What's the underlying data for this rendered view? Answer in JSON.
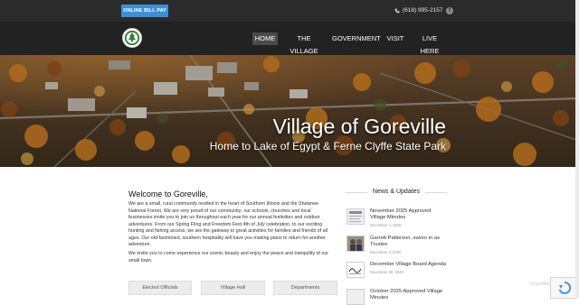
{
  "topbar": {
    "pay_label": "ONLINE BILL PAY",
    "phone": "(618) 995-2157",
    "fb_glyph": "f"
  },
  "nav": {
    "items": [
      "HOME",
      "THE VILLAGE",
      "GOVERNMENT",
      "VISIT",
      "LIVE HERE"
    ],
    "active": "HOME"
  },
  "hero": {
    "title": "Village of Goreville",
    "subtitle": "Home to Lake of Egypt & Ferne Clyffe State Park"
  },
  "welcome": {
    "title": "Welcome to Goreville,",
    "p1": "We are a small, rural community nestled in the heart of Southern Illinois and the Shawnee National Forest. We are very proud of our community; our schools, churches and local businesses invite you to join us throughout each year for our annual festivities and outdoor adventures.  From our Spring Fling and Freedom Fest 4th of July celebration, to our exciting hunting and fishing access, we are the gateway to great activities for families and friends of all ages.  Our old-fashioned, southern hospitality will have you making plans to return for another adventure.",
    "p2": "We invite you to come experience our scenic beauty and enjoy the peace and tranquility of our small town."
  },
  "quick_links": [
    "Elected Officials",
    "Village Hall",
    "Departments"
  ],
  "news": {
    "heading": "News & Updates",
    "items": [
      {
        "title": "November 2025 Approved Village Minutes",
        "date": "December 4, 2025"
      },
      {
        "title": "Garrett Patterson, sworn in as Trustee",
        "date": "December 3, 2025"
      },
      {
        "title": "December Village Board Agenda",
        "date": "November 28, 2025"
      },
      {
        "title": "October 2025 Approved Village Minutes",
        "date": ""
      }
    ]
  },
  "watermark": "ScanMal",
  "colors": {
    "pay_button": "#3b8fd6",
    "nav_bg": "#222222",
    "topbar_bg": "#2b2b2b",
    "active_nav": "#4b4b4b"
  },
  "icons": {
    "phone": "phone-icon",
    "facebook": "facebook-icon",
    "logo": "village-seal-logo",
    "recaptcha": "recaptcha-icon"
  }
}
